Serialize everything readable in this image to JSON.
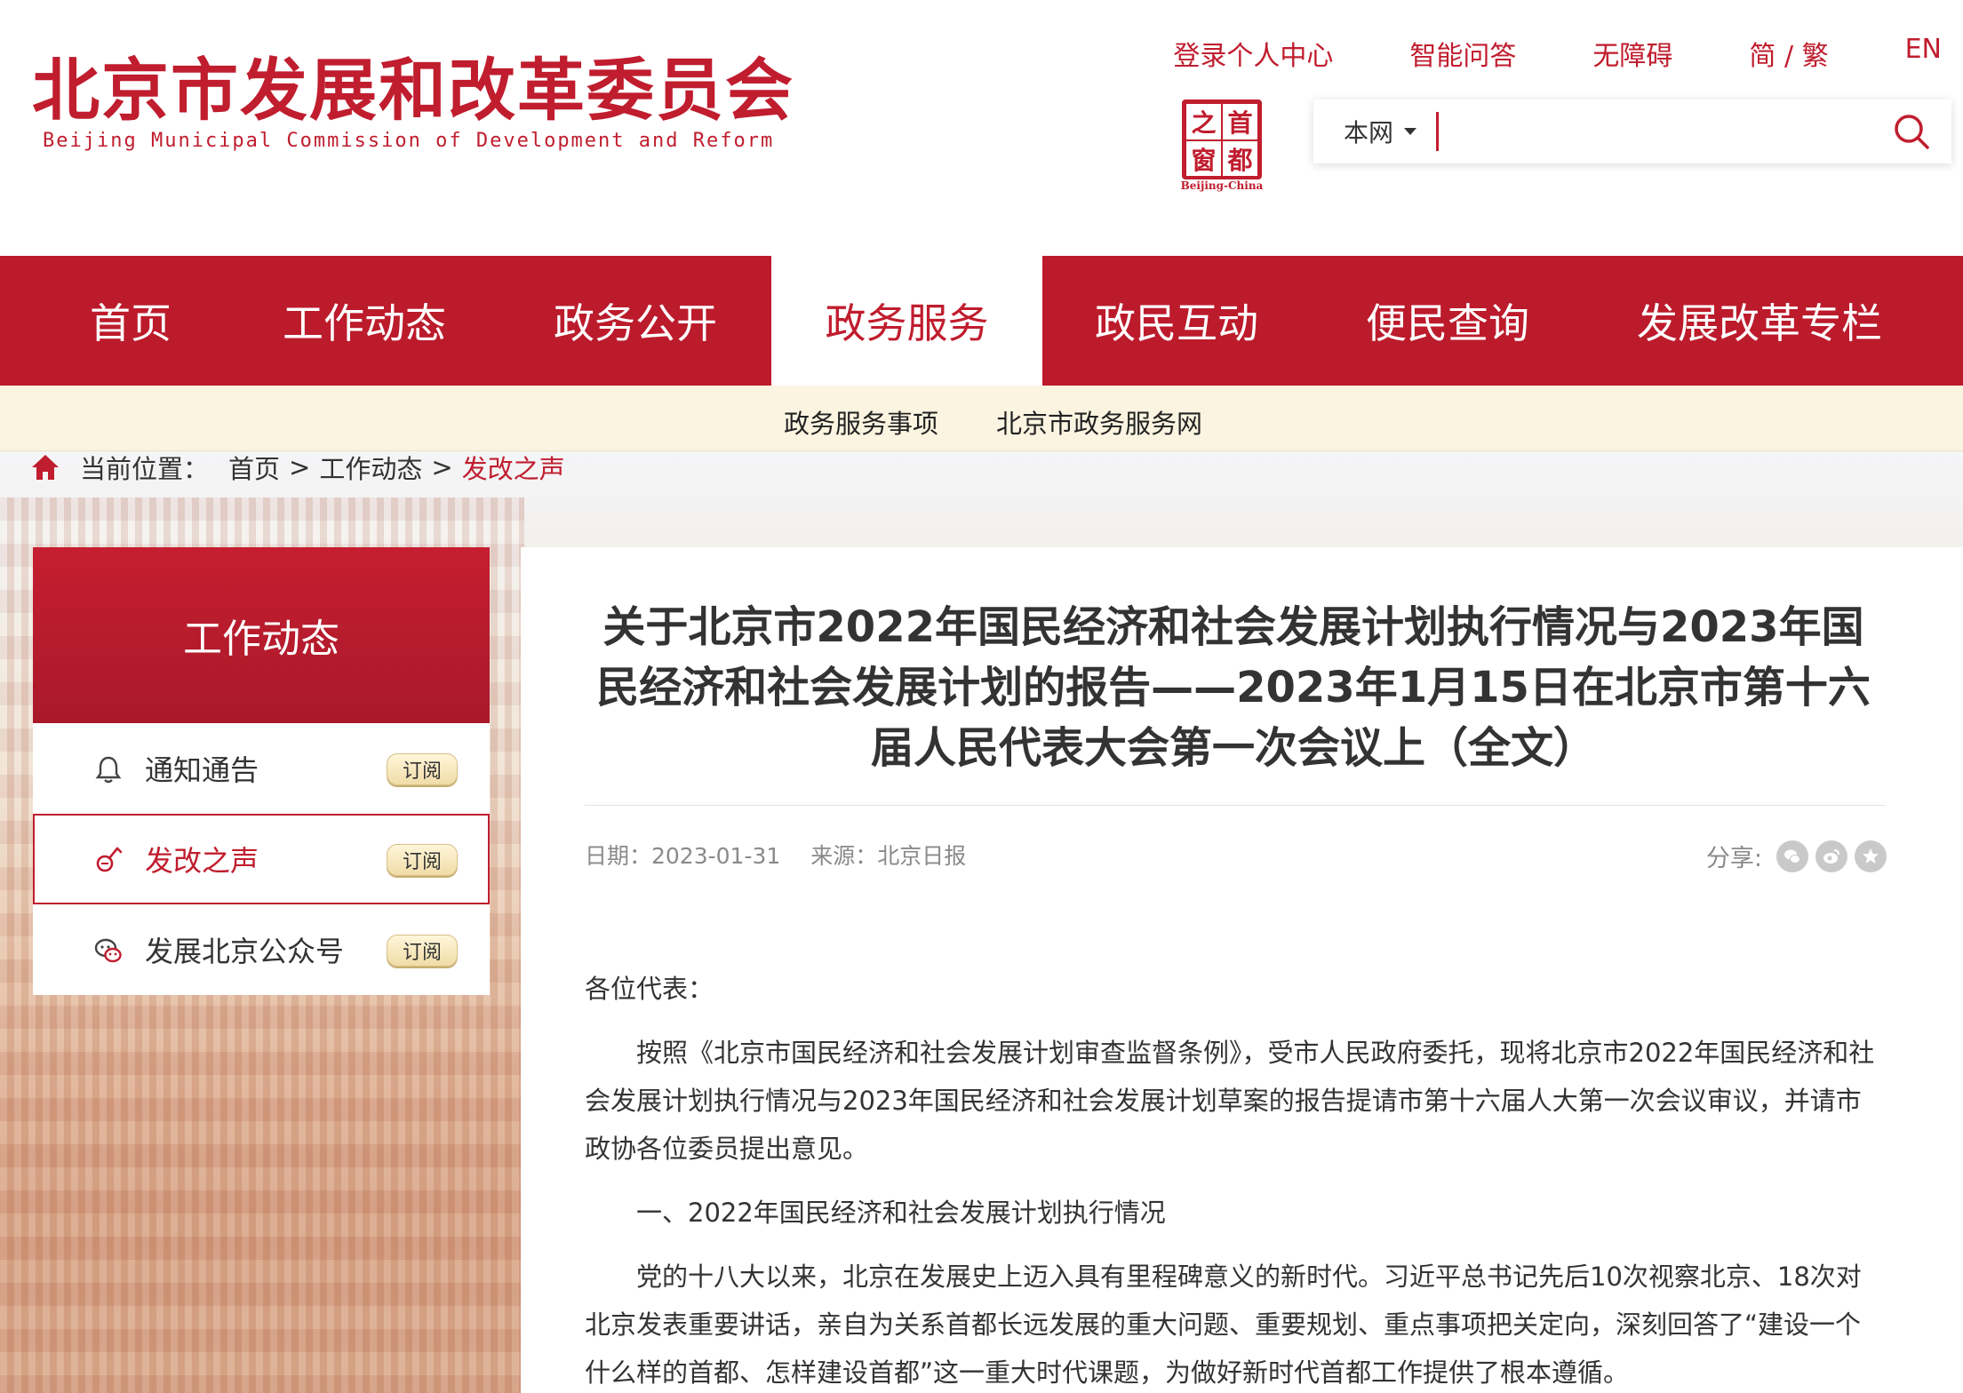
{
  "header": {
    "logo_cn": "北京市发展和改革委员会",
    "logo_en": "Beijing Municipal Commission of Development and Reform",
    "top_links": [
      "登录个人中心",
      "智能问答",
      "无障碍",
      "简 / 繁",
      "EN"
    ],
    "seal_chars": [
      "之",
      "首",
      "窗",
      "都"
    ],
    "seal_caption": "Beijing-China",
    "search": {
      "scope": "本网",
      "value": "",
      "placeholder": ""
    }
  },
  "nav": {
    "items": [
      "首页",
      "工作动态",
      "政务公开",
      "政务服务",
      "政民互动",
      "便民查询",
      "发展改革专栏"
    ],
    "active": "政务服务"
  },
  "subnav": {
    "items": [
      "政务服务事项",
      "北京市政务服务网"
    ]
  },
  "breadcrumb": {
    "label": "当前位置：",
    "items": [
      "首页",
      "工作动态",
      "发改之声"
    ],
    "separator": ">"
  },
  "sidebar": {
    "title": "工作动态",
    "subscribe_label": "订阅",
    "items": [
      {
        "label": "通知通告",
        "icon": "bell-icon",
        "active": false
      },
      {
        "label": "发改之声",
        "icon": "microphone-icon",
        "active": true
      },
      {
        "label": "发展北京公众号",
        "icon": "wechat-icon",
        "active": false
      }
    ]
  },
  "article": {
    "title": "关于北京市2022年国民经济和社会发展计划执行情况与2023年国民经济和社会发展计划的报告——2023年1月15日在北京市第十六届人民代表大会第一次会议上（全文）",
    "date": "日期：2023-01-31",
    "source": "来源：北京日报",
    "share_label": "分享:",
    "share_icons": [
      "wechat-share-icon",
      "weibo-share-icon",
      "favorite-share-icon"
    ],
    "paragraphs": [
      "各位代表：",
      "按照《北京市国民经济和社会发展计划审查监督条例》，受市人民政府委托，现将北京市2022年国民经济和社会发展计划执行情况与2023年国民经济和社会发展计划草案的报告提请市第十六届人大第一次会议审议，并请市政协各位委员提出意见。",
      "一、2022年国民经济和社会发展计划执行情况",
      "党的十八大以来，北京在发展史上迈入具有里程碑意义的新时代。习近平总书记先后10次视察北京、18次对北京发表重要讲话，亲自为关系首都长远发展的重大问题、重要规划、重点事项把关定向，深刻回答了“建设一个什么样的首都、怎样建设首都”这一重大时代课题，为做好新时代首都工作提供了根本遵循。"
    ]
  },
  "colors": {
    "brand_red": "#bc1b2c",
    "subnav_bg": "#fbf4e1",
    "meta_gray": "#8a8a8a"
  }
}
